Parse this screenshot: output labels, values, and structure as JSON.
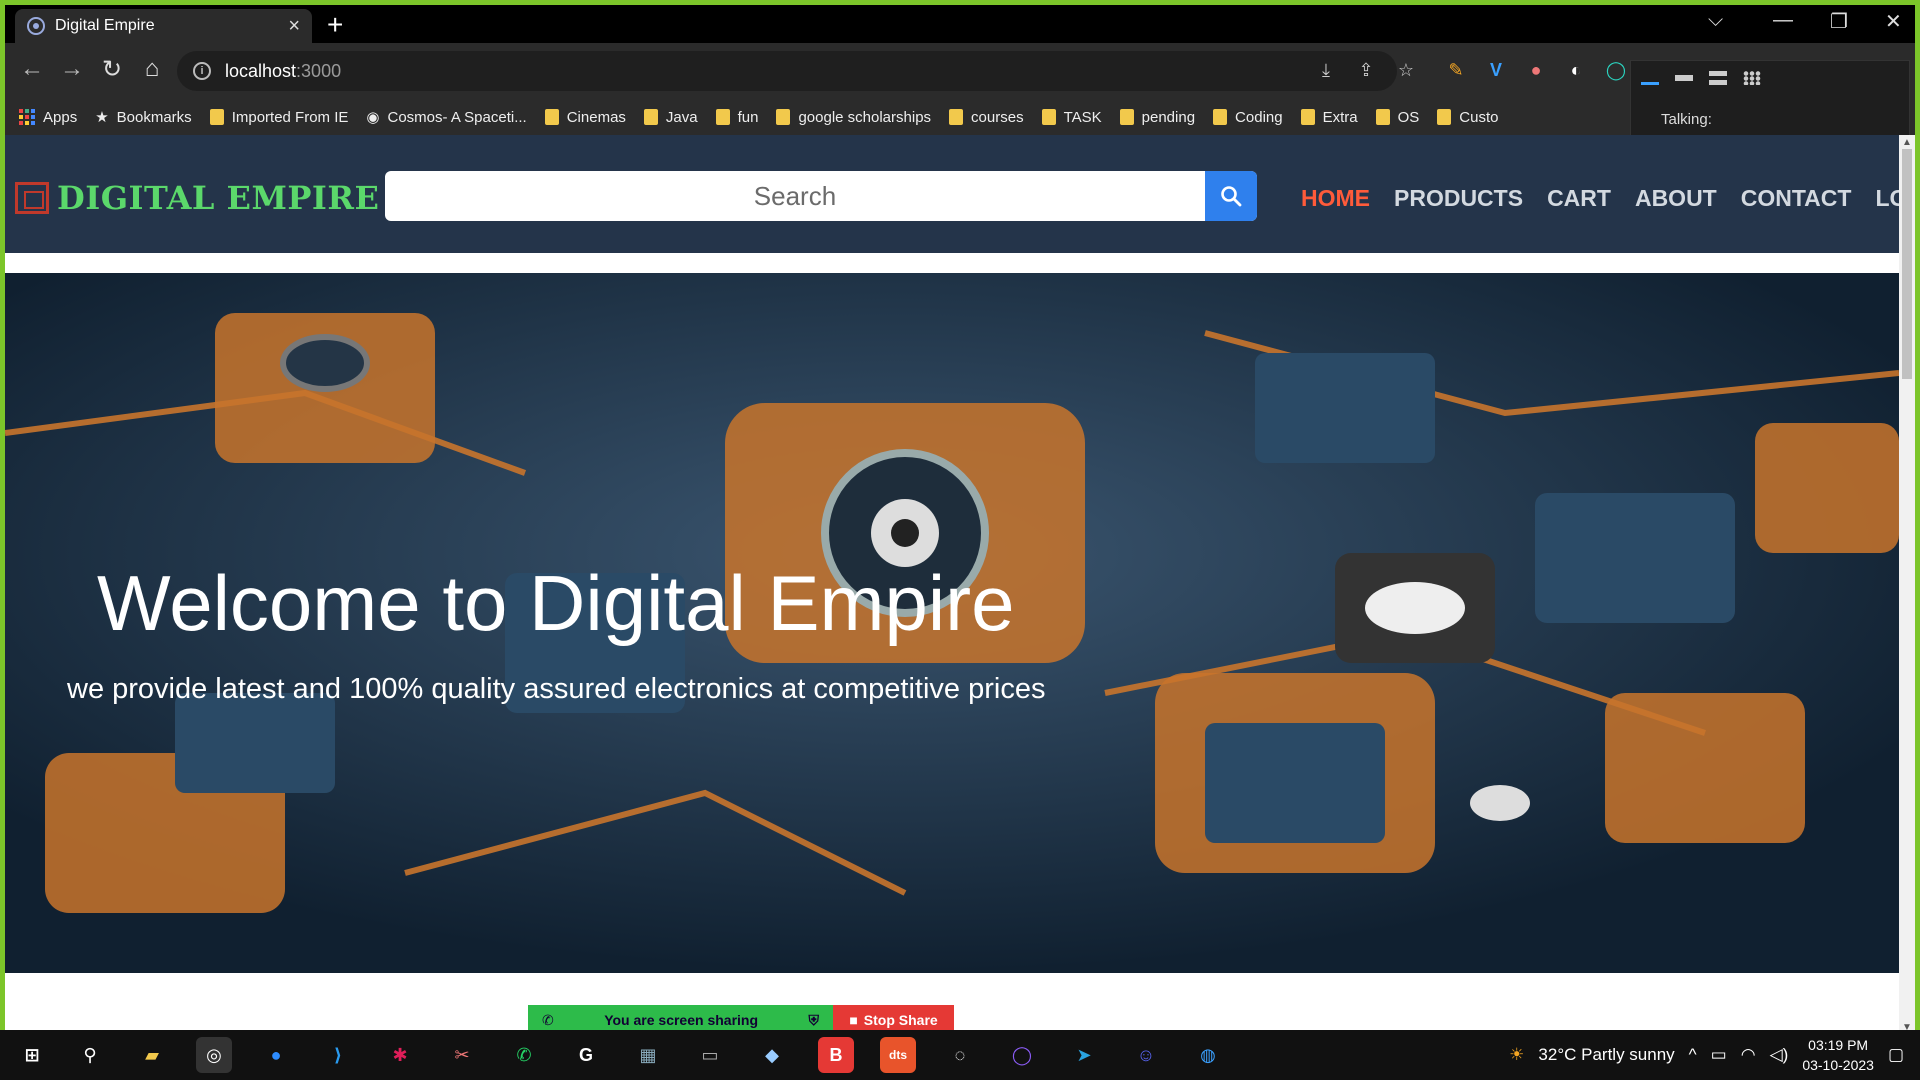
{
  "browser": {
    "tab_title": "Digital Empire",
    "tab_close": "×",
    "new_tab": "+",
    "url_host": "localhost",
    "url_port": ":3000",
    "window_controls": [
      "⌵",
      "—",
      "❐",
      "✕"
    ]
  },
  "bookmarks": [
    {
      "label": "Apps",
      "icon": "apps-grid"
    },
    {
      "label": "Bookmarks",
      "icon": "star-icon"
    },
    {
      "label": "Imported From IE",
      "icon": "folder"
    },
    {
      "label": "Cosmos- A Spaceti...",
      "icon": "globe-icon"
    },
    {
      "label": "Cinemas",
      "icon": "folder"
    },
    {
      "label": "Java",
      "icon": "folder"
    },
    {
      "label": "fun",
      "icon": "folder"
    },
    {
      "label": "google scholarships",
      "icon": "folder"
    },
    {
      "label": "courses",
      "icon": "folder"
    },
    {
      "label": "TASK",
      "icon": "folder"
    },
    {
      "label": "pending",
      "icon": "folder"
    },
    {
      "label": "Coding",
      "icon": "folder"
    },
    {
      "label": "Extra",
      "icon": "folder"
    },
    {
      "label": "OS",
      "icon": "folder"
    },
    {
      "label": "Custo",
      "icon": "folder"
    }
  ],
  "talking_widget": {
    "label": "Talking:"
  },
  "site": {
    "logo_text": "DIGITAL EMPIRE",
    "search_placeholder": "Search",
    "menu": [
      {
        "label": "HOME",
        "active": true
      },
      {
        "label": "PRODUCTS",
        "active": false
      },
      {
        "label": "CART",
        "active": false
      },
      {
        "label": "ABOUT",
        "active": false
      },
      {
        "label": "CONTACT",
        "active": false
      },
      {
        "label": "LOGIN",
        "active": false
      }
    ],
    "hero_title": "Welcome to Digital Empire",
    "hero_subtitle": "we provide latest and 100% quality assured electronics at competitive prices"
  },
  "screen_share": {
    "status": "You are screen sharing",
    "stop_label": "Stop Share"
  },
  "taskbar": {
    "weather": "32°C  Partly sunny",
    "time": "03:19 PM",
    "date": "03-10-2023",
    "apps": [
      "start",
      "search",
      "file-explorer",
      "chrome",
      "zoom",
      "vscode",
      "slack",
      "snip",
      "whatsapp",
      "github",
      "calculator",
      "terminal",
      "notes",
      "brave",
      "dts",
      "obs",
      "app-circle",
      "telegram",
      "discord",
      "firefox"
    ]
  },
  "colors": {
    "accent_active_menu": "#ff5b3a",
    "nav_background": "#24344a",
    "logo_green": "#5bd86b",
    "search_button": "#2f80ed",
    "frame_border": "#7cc52a"
  }
}
